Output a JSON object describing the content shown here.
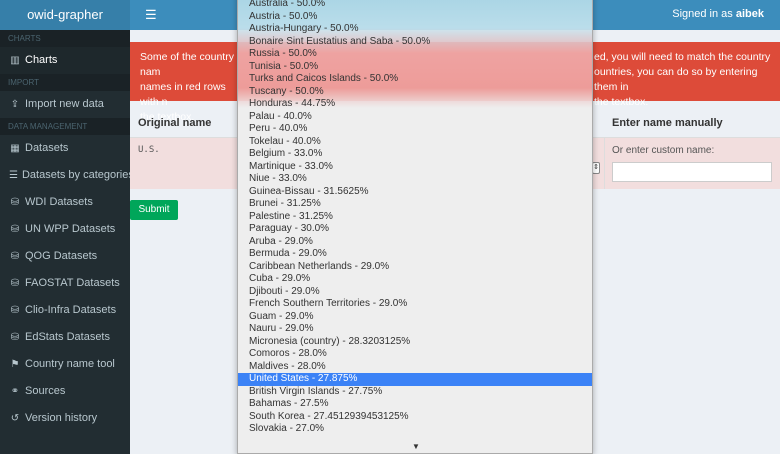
{
  "app": {
    "title": "owid-grapher",
    "signed_in_prefix": "Signed in as",
    "user": "aibek",
    "menu_icon": "hamburger-icon"
  },
  "sidebar": {
    "sections": [
      {
        "header": "CHARTS",
        "items": [
          {
            "label": "Charts",
            "icon": "chart-icon",
            "glyph": "▥",
            "active": true
          }
        ]
      },
      {
        "header": "IMPORT",
        "items": [
          {
            "label": "Import new data",
            "icon": "upload-icon",
            "glyph": "⇪"
          }
        ]
      },
      {
        "header": "DATA MANAGEMENT",
        "items": [
          {
            "label": "Datasets",
            "icon": "table-icon",
            "glyph": "▦"
          },
          {
            "label": "Datasets by categories",
            "icon": "list-icon",
            "glyph": "☰"
          },
          {
            "label": "WDI Datasets",
            "icon": "database-icon",
            "glyph": "⛁"
          },
          {
            "label": "UN WPP Datasets",
            "icon": "database-icon",
            "glyph": "⛁"
          },
          {
            "label": "QOG Datasets",
            "icon": "database-icon",
            "glyph": "⛁"
          },
          {
            "label": "FAOSTAT Datasets",
            "icon": "database-icon",
            "glyph": "⛁"
          },
          {
            "label": "Clio-Infra Datasets",
            "icon": "database-icon",
            "glyph": "⛁"
          },
          {
            "label": "EdStats Datasets",
            "icon": "database-icon",
            "glyph": "⛁"
          },
          {
            "label": "Country name tool",
            "icon": "flag-icon",
            "glyph": "⚑"
          },
          {
            "label": "Sources",
            "icon": "link-icon",
            "glyph": "⚭"
          },
          {
            "label": "Version history",
            "icon": "history-icon",
            "glyph": "↺"
          }
        ]
      }
    ]
  },
  "alert": {
    "left": "Some of the country names in red rows with no match",
    "right": "ed, you will need to match the country names in red rows with no match, you can do so by entering them in the textbox.",
    "right_display": "ed, you will need to match the country\nountries, you can do so by entering them in\nthe textbox.",
    "left_display": "Some of the country nam\nnames in red rows with n\nthe textbox."
  },
  "table": {
    "col_original": "Original name",
    "col_manual": "Enter name manually",
    "row": {
      "original": "U.S.",
      "custom_label": "Or enter custom name:",
      "custom_value": ""
    }
  },
  "submit_label": "Submit",
  "dropdown": {
    "selected_index": 30,
    "options": [
      "Australia - 50.0%",
      "Austria - 50.0%",
      "Austria-Hungary - 50.0%",
      "Bonaire Sint Eustatius and Saba - 50.0%",
      "Russia - 50.0%",
      "Tunisia - 50.0%",
      "Turks and Caicos Islands - 50.0%",
      "Tuscany - 50.0%",
      "Honduras - 44.75%",
      "Palau - 40.0%",
      "Peru - 40.0%",
      "Tokelau - 40.0%",
      "Belgium - 33.0%",
      "Martinique - 33.0%",
      "Niue - 33.0%",
      "Guinea-Bissau - 31.5625%",
      "Brunei - 31.25%",
      "Palestine - 31.25%",
      "Paraguay - 30.0%",
      "Aruba - 29.0%",
      "Bermuda - 29.0%",
      "Caribbean Netherlands - 29.0%",
      "Cuba - 29.0%",
      "Djibouti - 29.0%",
      "French Southern Territories - 29.0%",
      "Guam - 29.0%",
      "Nauru - 29.0%",
      "Micronesia (country) - 28.3203125%",
      "Comoros - 28.0%",
      "Maldives - 28.0%",
      "United States - 27.875%",
      "British Virgin Islands - 27.75%",
      "Bahamas - 27.5%",
      "South Korea - 27.4512939453125%",
      "Slovakia - 27.0%"
    ],
    "scroll_arrow": "▼"
  }
}
